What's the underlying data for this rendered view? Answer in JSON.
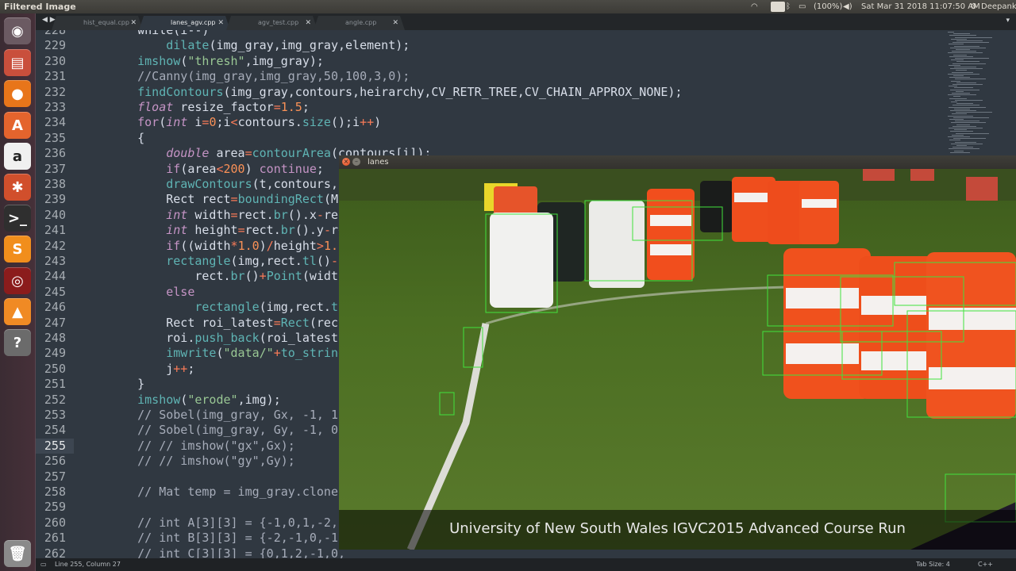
{
  "topbar": {
    "window_title": "Filtered Image",
    "keyboard": "En",
    "battery": "(100%)",
    "datetime": "Sat Mar 31 2018 11:07:50 AM",
    "user": "Deepank"
  },
  "launcher": {
    "items": [
      {
        "name": "ubuntu-dash-icon",
        "glyph": "◉",
        "color": "#6b5a62"
      },
      {
        "name": "files-icon",
        "glyph": "▤",
        "color": "#c94f3c"
      },
      {
        "name": "firefox-icon",
        "glyph": "●",
        "color": "#e8751a"
      },
      {
        "name": "software-center-icon",
        "glyph": "A",
        "color": "#e4642d"
      },
      {
        "name": "amazon-icon",
        "glyph": "a",
        "color": "#f0f0f0"
      },
      {
        "name": "system-settings-icon",
        "glyph": "✱",
        "color": "#d14f2c"
      },
      {
        "name": "terminal-icon",
        "glyph": ">_",
        "color": "#2f2f2f"
      },
      {
        "name": "sublime-text-icon",
        "glyph": "S",
        "color": "#f18e1c"
      },
      {
        "name": "disk-utility-icon",
        "glyph": "◎",
        "color": "#8b1c1c"
      },
      {
        "name": "vlc-icon",
        "glyph": "▲",
        "color": "#f08a24"
      },
      {
        "name": "help-icon",
        "glyph": "?",
        "color": "#6b6b6b"
      }
    ],
    "trash": {
      "name": "trash-icon",
      "glyph": "🗑",
      "color": "#8a8a8a"
    }
  },
  "tabs": [
    {
      "label": "hist_equal.cpp",
      "active": false
    },
    {
      "label": "lanes_agv.cpp",
      "active": true
    },
    {
      "label": "agv_test.cpp",
      "active": false
    },
    {
      "label": "angle.cpp",
      "active": false
    }
  ],
  "editor": {
    "current_line": 255,
    "lines": [
      {
        "n": "228",
        "code": [
          [
            "    ",
            ""
          ],
          [
            "while(i--)",
            "id"
          ]
        ]
      },
      {
        "n": "229",
        "code": [
          [
            "        ",
            ""
          ],
          [
            "dilate",
            "fn"
          ],
          [
            "(img_gray,img_gray,element);",
            "id"
          ]
        ]
      },
      {
        "n": "230",
        "code": [
          [
            "    ",
            ""
          ],
          [
            "imshow",
            "fn"
          ],
          [
            "(",
            "id"
          ],
          [
            "\"thresh\"",
            "str"
          ],
          [
            ",img_gray);",
            "id"
          ]
        ]
      },
      {
        "n": "231",
        "code": [
          [
            "    ",
            ""
          ],
          [
            "//Canny(img_gray,img_gray,50,100,3,0);",
            "cm"
          ]
        ]
      },
      {
        "n": "232",
        "code": [
          [
            "    ",
            ""
          ],
          [
            "findContours",
            "fn"
          ],
          [
            "(img_gray,contours,heirarchy,CV_RETR_TREE,CV_CHAIN_APPROX_NONE);",
            "id"
          ]
        ]
      },
      {
        "n": "233",
        "code": [
          [
            "    ",
            ""
          ],
          [
            "float",
            "ty"
          ],
          [
            " resize_factor",
            "id"
          ],
          [
            "=",
            "op"
          ],
          [
            "1.5",
            "num"
          ],
          [
            ";",
            "id"
          ]
        ]
      },
      {
        "n": "234",
        "code": [
          [
            "    ",
            ""
          ],
          [
            "for",
            "kw"
          ],
          [
            "(",
            "id"
          ],
          [
            "int",
            "ty"
          ],
          [
            " i",
            "id"
          ],
          [
            "=",
            "op"
          ],
          [
            "0",
            "num"
          ],
          [
            ";i",
            "id"
          ],
          [
            "<",
            "op"
          ],
          [
            "contours.",
            "id"
          ],
          [
            "size",
            "fn"
          ],
          [
            "();i",
            "id"
          ],
          [
            "++",
            "op"
          ],
          [
            ")",
            "id"
          ]
        ]
      },
      {
        "n": "235",
        "code": [
          [
            "    {",
            "id"
          ]
        ]
      },
      {
        "n": "236",
        "code": [
          [
            "        ",
            ""
          ],
          [
            "double",
            "ty"
          ],
          [
            " area",
            "id"
          ],
          [
            "=",
            "op"
          ],
          [
            "contourArea",
            "fn"
          ],
          [
            "(contours[i]);",
            "id"
          ]
        ]
      },
      {
        "n": "237",
        "code": [
          [
            "        ",
            ""
          ],
          [
            "if",
            "kw"
          ],
          [
            "(area",
            "id"
          ],
          [
            "<",
            "op"
          ],
          [
            "200",
            "num"
          ],
          [
            ") ",
            "id"
          ],
          [
            "continue",
            "kw"
          ],
          [
            ";",
            "id"
          ]
        ]
      },
      {
        "n": "238",
        "code": [
          [
            "        ",
            ""
          ],
          [
            "drawContours",
            "fn"
          ],
          [
            "(t,contours,i",
            "id"
          ]
        ]
      },
      {
        "n": "239",
        "code": [
          [
            "        Rect rect",
            "id"
          ],
          [
            "=",
            "op"
          ],
          [
            "boundingRect",
            "fn"
          ],
          [
            "(Ma",
            "id"
          ]
        ]
      },
      {
        "n": "240",
        "code": [
          [
            "        ",
            ""
          ],
          [
            "int",
            "ty"
          ],
          [
            " width",
            "id"
          ],
          [
            "=",
            "op"
          ],
          [
            "rect.",
            "id"
          ],
          [
            "br",
            "fn"
          ],
          [
            "().x",
            "id"
          ],
          [
            "-",
            "op"
          ],
          [
            "rec",
            "id"
          ]
        ]
      },
      {
        "n": "241",
        "code": [
          [
            "        ",
            ""
          ],
          [
            "int",
            "ty"
          ],
          [
            " height",
            "id"
          ],
          [
            "=",
            "op"
          ],
          [
            "rect.",
            "id"
          ],
          [
            "br",
            "fn"
          ],
          [
            "().y",
            "id"
          ],
          [
            "-",
            "op"
          ],
          [
            "re",
            "id"
          ]
        ]
      },
      {
        "n": "242",
        "code": [
          [
            "        ",
            ""
          ],
          [
            "if",
            "kw"
          ],
          [
            "((width",
            "id"
          ],
          [
            "*",
            "op"
          ],
          [
            "1.0",
            "num"
          ],
          [
            ")",
            "id"
          ],
          [
            "/",
            "op"
          ],
          [
            "height",
            "id"
          ],
          [
            ">",
            "op"
          ],
          [
            "1.5",
            "num"
          ]
        ]
      },
      {
        "n": "243",
        "code": [
          [
            "        ",
            ""
          ],
          [
            "rectangle",
            "fn"
          ],
          [
            "(img,rect.",
            "id"
          ],
          [
            "tl",
            "fn"
          ],
          [
            "()",
            "id"
          ],
          [
            "-",
            "op"
          ],
          [
            "P",
            "id"
          ]
        ]
      },
      {
        "n": "244",
        "code": [
          [
            "            rect.",
            "id"
          ],
          [
            "br",
            "fn"
          ],
          [
            "()",
            "id"
          ],
          [
            "+",
            "op"
          ],
          [
            "Point",
            "fn"
          ],
          [
            "(width",
            "id"
          ]
        ]
      },
      {
        "n": "245",
        "code": [
          [
            "        ",
            ""
          ],
          [
            "else",
            "kw"
          ]
        ]
      },
      {
        "n": "246",
        "code": [
          [
            "            ",
            ""
          ],
          [
            "rectangle",
            "fn"
          ],
          [
            "(img,rect.",
            "id"
          ],
          [
            "tl",
            "fn"
          ]
        ]
      },
      {
        "n": "247",
        "code": [
          [
            "        Rect roi_latest",
            "id"
          ],
          [
            "=",
            "op"
          ],
          [
            "Rect",
            "fn"
          ],
          [
            "(rect",
            "id"
          ]
        ]
      },
      {
        "n": "248",
        "code": [
          [
            "        roi.",
            "id"
          ],
          [
            "push_back",
            "fn"
          ],
          [
            "(roi_latest)",
            "id"
          ]
        ]
      },
      {
        "n": "249",
        "code": [
          [
            "        ",
            ""
          ],
          [
            "imwrite",
            "fn"
          ],
          [
            "(",
            "id"
          ],
          [
            "\"data/\"",
            "str"
          ],
          [
            "+",
            "op"
          ],
          [
            "to_string",
            "fn"
          ]
        ]
      },
      {
        "n": "250",
        "code": [
          [
            "        j",
            "id"
          ],
          [
            "++",
            "op"
          ],
          [
            ";",
            "id"
          ]
        ]
      },
      {
        "n": "251",
        "code": [
          [
            "    }",
            "id"
          ]
        ]
      },
      {
        "n": "252",
        "code": [
          [
            "    ",
            ""
          ],
          [
            "imshow",
            "fn"
          ],
          [
            "(",
            "id"
          ],
          [
            "\"erode\"",
            "str"
          ],
          [
            ",img);",
            "id"
          ]
        ]
      },
      {
        "n": "253",
        "code": [
          [
            "    ",
            ""
          ],
          [
            "// Sobel(img_gray, Gx, -1, 1,",
            "cm"
          ]
        ]
      },
      {
        "n": "254",
        "code": [
          [
            "    ",
            ""
          ],
          [
            "// Sobel(img_gray, Gy, -1, 0,",
            "cm"
          ]
        ]
      },
      {
        "n": "255",
        "code": [
          [
            "    ",
            ""
          ],
          [
            "// // imshow(\"gx\",Gx);",
            "cm"
          ]
        ]
      },
      {
        "n": "256",
        "code": [
          [
            "    ",
            ""
          ],
          [
            "// // imshow(\"gy\",Gy);",
            "cm"
          ]
        ]
      },
      {
        "n": "257",
        "code": []
      },
      {
        "n": "258",
        "code": [
          [
            "    ",
            ""
          ],
          [
            "// Mat temp = img_gray.clone(",
            "cm"
          ]
        ]
      },
      {
        "n": "259",
        "code": []
      },
      {
        "n": "260",
        "code": [
          [
            "    ",
            ""
          ],
          [
            "// int A[3][3] = {-1,0,1,-2,0",
            "cm"
          ]
        ]
      },
      {
        "n": "261",
        "code": [
          [
            "    ",
            ""
          ],
          [
            "// int B[3][3] = {-2,-1,0,-1,",
            "cm"
          ]
        ]
      },
      {
        "n": "262",
        "code": [
          [
            "    ",
            ""
          ],
          [
            "// int C[3][3] = {0,1,2,-1,0,",
            "cm"
          ]
        ]
      }
    ]
  },
  "status": {
    "position": "Line 255, Column 27",
    "tab_size": "Tab Size: 4",
    "syntax": "C++"
  },
  "lanes_window": {
    "title": "lanes",
    "caption": "University of New South Wales IGVC2015 Advanced Course Run"
  }
}
